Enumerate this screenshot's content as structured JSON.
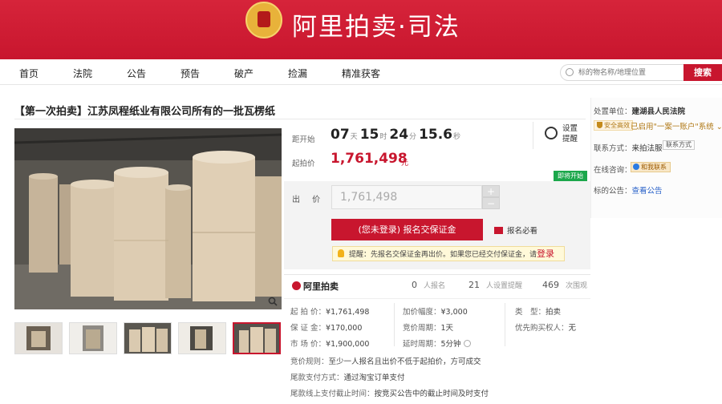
{
  "header": {
    "brand": "阿里拍卖·司法"
  },
  "nav": {
    "items": [
      "首页",
      "法院",
      "公告",
      "预告",
      "破产",
      "捡漏",
      "精准获客"
    ]
  },
  "search": {
    "placeholder": "标的物名称/地理位置",
    "button": "搜索"
  },
  "item": {
    "title": "【第一次拍卖】江苏凤程纸业有限公司所有的一批瓦楞纸"
  },
  "countdown": {
    "label": "距开始",
    "days": "07",
    "days_unit": "天",
    "hours": "15",
    "hours_unit": "时",
    "minutes": "24",
    "minutes_unit": "分",
    "seconds": "15.6",
    "seconds_unit": "秒"
  },
  "price": {
    "label": "起拍价",
    "value": "1,761,498",
    "unit": "元"
  },
  "reminder": {
    "label": "设置提醒"
  },
  "status_badge": "即将开始",
  "bid": {
    "label": "出 价",
    "value": "1,761,498",
    "plus": "+",
    "minus": "−",
    "register_button": "(您未登录) 报名交保证金",
    "must_read": "报名必看",
    "tip_prefix": "提醒：先报名交保证金再出价。如果您已经交付保证金，请",
    "tip_login": "登录"
  },
  "stats": {
    "logo": "阿里拍卖",
    "signups": "0",
    "signups_label": "人报名",
    "reminders": "21",
    "reminders_label": "人设置提醒",
    "views": "469",
    "views_label": "次围观"
  },
  "details": {
    "start_price": {
      "k": "起 拍 价：",
      "v": "¥1,761,498"
    },
    "deposit": {
      "k": "保 证 金：",
      "v": "¥170,000"
    },
    "market_price": {
      "k": "市 场 价：",
      "v": "¥1,900,000"
    },
    "increment": {
      "k": "加价幅度：",
      "v": "¥3,000"
    },
    "period": {
      "k": "竞价周期：",
      "v": "1天"
    },
    "extension": {
      "k": "延时周期：",
      "v": "5分钟"
    },
    "type": {
      "k": "类　型：",
      "v": "拍卖"
    },
    "priority": {
      "k": "优先购买权人：",
      "v": "无"
    },
    "rule": {
      "k": "竞价规则：",
      "v": "至少一人报名且出价不低于起拍价，方可成交"
    },
    "payment": {
      "k": "尾款支付方式：",
      "v": "通过淘宝订单支付"
    },
    "deadline": {
      "k": "尾款线上支付截止时间：",
      "v": "按竞买公告中的截止时间及时支付"
    }
  },
  "side": {
    "court_label": "处置单位：",
    "court": "建湖县人民法院",
    "safe_badge": "安全高效",
    "system": "已启用\"一案一账户\"系统",
    "contact_label": "联系方式：",
    "contact": "来拍法服",
    "contact_tag": "联系方式",
    "consult_label": "在线咨询：",
    "consult_button": "和我联系",
    "notice_label": "标的公告：",
    "notice_link": "查看公告"
  }
}
